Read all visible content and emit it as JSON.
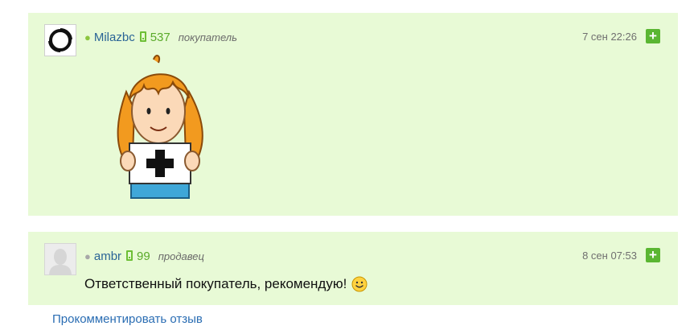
{
  "reviews": [
    {
      "username": "Milazbc",
      "rating": "537",
      "role": "покупатель",
      "date": "7 сен 22:26",
      "plus_label": "+",
      "avatar_icon": "ring-logo-icon",
      "content_icon": "girl-holding-plus-sign-sticker"
    },
    {
      "username": "ambr",
      "rating": "99",
      "role": "продавец",
      "date": "8 сен 07:53",
      "plus_label": "+",
      "avatar_icon": "default-user-avatar-icon",
      "text": "Ответственный покупатель, рекомендую!",
      "emoji_icon": "smiley-icon"
    }
  ],
  "footer": {
    "comment_link": "Прокомментировать отзыв"
  },
  "colors": {
    "review_bg": "#e8fad6",
    "accent_green": "#5ab632",
    "username_blue": "#2a6496",
    "link_blue": "#2a6db3"
  }
}
